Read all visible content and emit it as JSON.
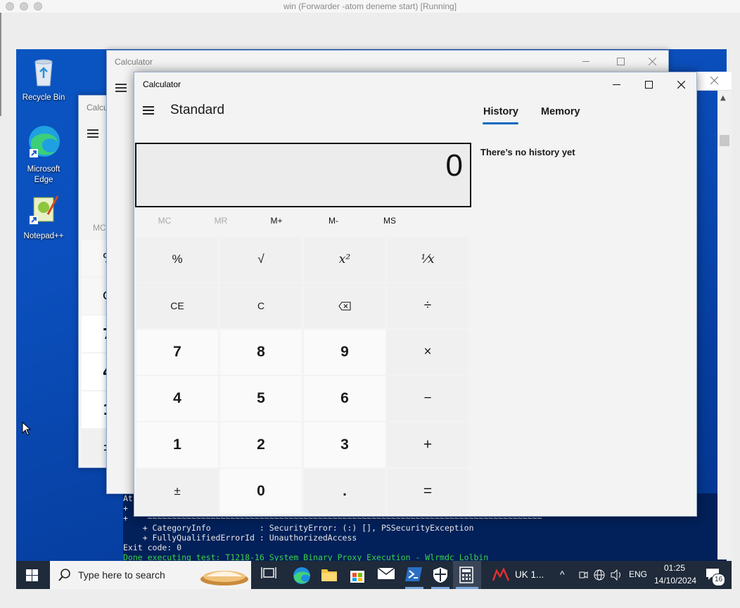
{
  "host": {
    "window_title": "win (Forwarder -atom deneme start) [Running]"
  },
  "desktop_icons": [
    {
      "label": "Recycle Bin"
    },
    {
      "label": "Microsoft Edge"
    },
    {
      "label": "Notepad++"
    }
  ],
  "background_windows": {
    "calc_back_title": "Calculator",
    "calc_back2_title": "Calcu",
    "partial_labels": [
      "MC",
      "%",
      "C",
      "7",
      "4",
      "1",
      "±"
    ]
  },
  "calculator": {
    "title": "Calculator",
    "mode": "Standard",
    "display_value": "0",
    "memory_buttons": [
      {
        "label": "MC",
        "enabled": false
      },
      {
        "label": "MR",
        "enabled": false
      },
      {
        "label": "M+",
        "enabled": true
      },
      {
        "label": "M-",
        "enabled": true
      },
      {
        "label": "MS",
        "enabled": true
      }
    ],
    "keys": [
      [
        "%",
        "√",
        "x²",
        "¹⁄x"
      ],
      [
        "CE",
        "C",
        "⌫",
        "÷"
      ],
      [
        "7",
        "8",
        "9",
        "×"
      ],
      [
        "4",
        "5",
        "6",
        "−"
      ],
      [
        "1",
        "2",
        "3",
        "+"
      ],
      [
        "±",
        "0",
        ".",
        "="
      ]
    ],
    "tabs": [
      {
        "label": "History",
        "active": true
      },
      {
        "label": "Memory",
        "active": false
      }
    ],
    "history_empty_text": "There’s no history yet"
  },
  "terminal": {
    "lines": [
      "At",
      "+",
      "+    ~~~~~~~~~~~~~~~~~~~~~~~~~~~~~~~~~~~~~~~~~~~~~~~~~~~~~~~~~~~~~~~~~~~~~~~~~~~~~~~~~",
      "    + CategoryInfo          : SecurityError: (:) [], PSSecurityException",
      "    + FullyQualifiedErrorId : UnauthorizedAccess",
      "Exit code: 0",
      "Done executing test: T1218-16 System Binary Proxy Execution - Wlrmdc Lolbin"
    ],
    "done_line_color": "#3bd34a"
  },
  "taskbar": {
    "search_placeholder": "Type here to search",
    "app_label": "UK 1...",
    "language": "ENG",
    "time": "01:25",
    "date": "14/10/2024",
    "notification_count": "16"
  },
  "colors": {
    "accent": "#0067c0",
    "desktop": "#0a55c2",
    "taskbar": "#1f2a3a"
  }
}
